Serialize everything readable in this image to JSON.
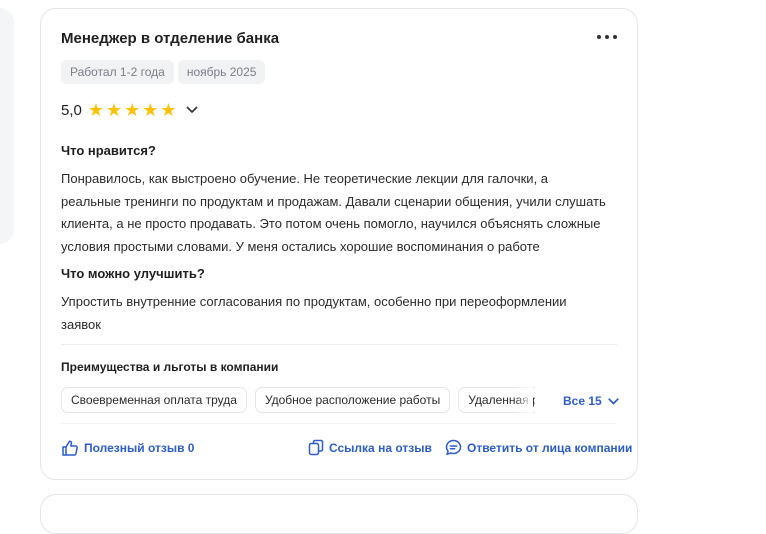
{
  "review": {
    "title": "Менеджер в отделение банка",
    "tags": [
      "Работал 1-2 года",
      "ноябрь 2025"
    ],
    "rating": "5,0",
    "stars_filled": 5,
    "pros_title": "Что нравится?",
    "pros_lines": [
      "Понравилось, как выстроено обучение. Не теоретические лекции для галочки, а",
      "реальные тренинги по продуктам и продажам. Давали сценарии общения, учили слушать",
      "клиента, а не просто продавать. Это потом очень помогло, научился объяснять сложные",
      "условия простыми словами. У меня остались хорошие воспоминания о работе"
    ],
    "cons_title": "Что можно улучшить?",
    "cons_lines": [
      "Упростить внутренние согласования по продуктам, особенно при переоформлении",
      "заявок"
    ],
    "benefits_title": "Преимущества и льготы в компании",
    "benefits": [
      "Своевременная оплата труда",
      "Удобное расположение работы",
      "Удаленная работа"
    ],
    "benefits_more": "Все 15",
    "actions": {
      "helpful": "Полезный отзыв 0",
      "link": "Ссылка на отзыв",
      "reply": "Ответить от лица компании"
    }
  },
  "colors": {
    "accent": "#2c5dcb",
    "star": "#ffc107",
    "tag_bg": "#f1f2f4"
  },
  "icons": [
    "more-icon",
    "star-icon",
    "chevron-down-icon",
    "thumbs-up-icon",
    "copy-icon",
    "chat-icon"
  ]
}
